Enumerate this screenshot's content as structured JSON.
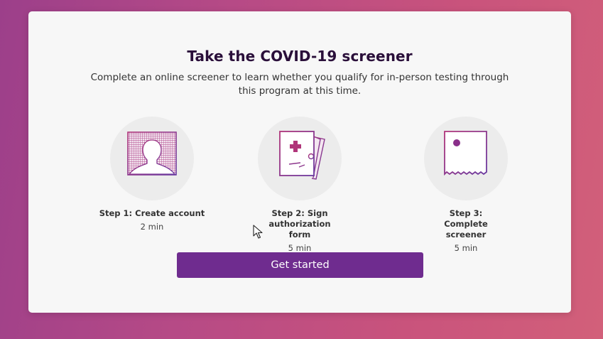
{
  "card": {
    "title": "Take the COVID-19 screener",
    "subtitle": "Complete an online screener to learn whether you qualify for in-person testing through this program at this time."
  },
  "steps": [
    {
      "label": "Step 1: Create account",
      "time": "2 min",
      "icon": "person-silhouette-icon"
    },
    {
      "label": "Step 2: Sign authorization form",
      "time": "5 min",
      "icon": "medical-form-icon"
    },
    {
      "label": "Step 3: Complete screener",
      "time": "5 min",
      "icon": "screener-document-icon"
    }
  ],
  "cta": {
    "label": "Get started"
  },
  "colors": {
    "accent": "#6f2c8f",
    "title": "#2a0f3a",
    "icon_gradient_start": "#b0357a",
    "icon_gradient_end": "#6a3aa0"
  }
}
